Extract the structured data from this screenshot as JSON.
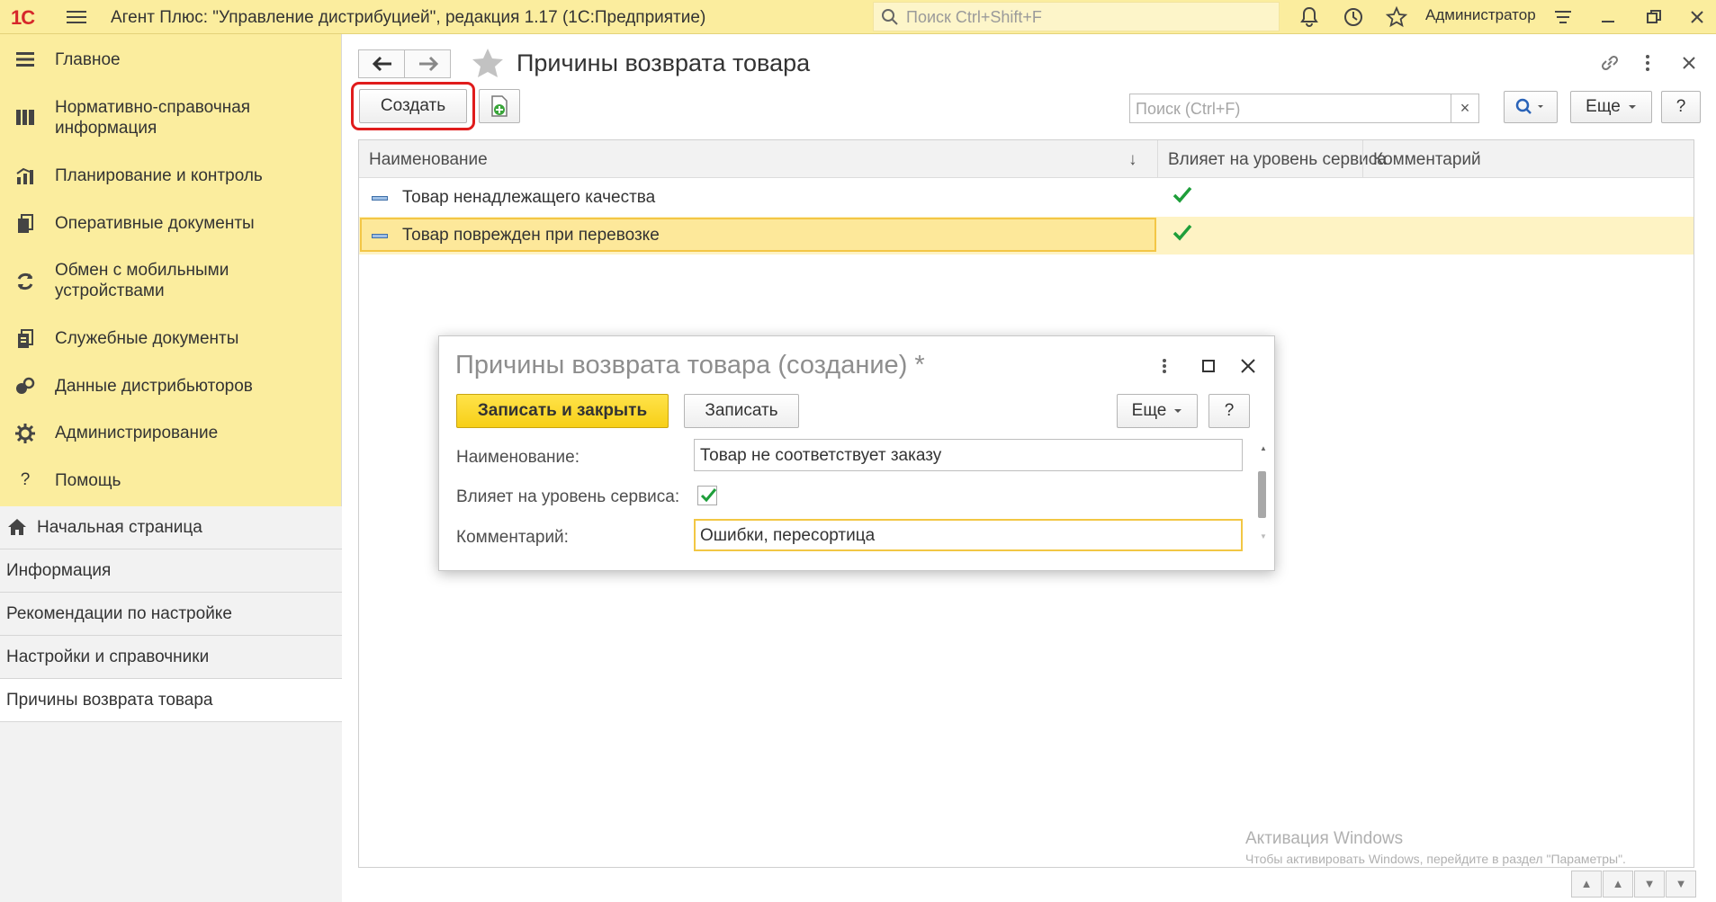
{
  "titlebar": {
    "logo": "1С",
    "title": "Агент Плюс: \"Управление дистрибуцией\", редакция 1.17  (1С:Предприятие)",
    "search_placeholder": "Поиск Ctrl+Shift+F",
    "user": "Администратор"
  },
  "sidebar": {
    "sections": [
      {
        "label": "Главное",
        "icon": "menu-lines-icon"
      },
      {
        "label": "Нормативно-справочная информация",
        "icon": "bars-chart-icon"
      },
      {
        "label": "Планирование и контроль",
        "icon": "growth-chart-icon"
      },
      {
        "label": "Оперативные документы",
        "icon": "documents-icon"
      },
      {
        "label": "Обмен с мобильными устройствами",
        "icon": "sync-icon"
      },
      {
        "label": "Служебные документы",
        "icon": "service-docs-icon"
      },
      {
        "label": "Данные дистрибьюторов",
        "icon": "distributors-icon"
      },
      {
        "label": "Администрирование",
        "icon": "gear-icon"
      },
      {
        "label": "Помощь",
        "icon": "question-icon"
      }
    ],
    "open_windows": [
      {
        "label": "Начальная страница",
        "icon": "home-icon"
      },
      {
        "label": "Информация"
      },
      {
        "label": "Рекомендации по настройке"
      },
      {
        "label": "Настройки и справочники"
      },
      {
        "label": "Причины возврата товара"
      }
    ]
  },
  "main": {
    "title": "Причины возврата товара",
    "create_label": "Создать",
    "search_placeholder": "Поиск (Ctrl+F)",
    "search_clear": "×",
    "more_label": "Еще",
    "help_label": "?",
    "columns": [
      "Наименование",
      "Влияет на уровень сервиса",
      "Комментарий"
    ],
    "sort_indicator": "↓",
    "rows": [
      {
        "name": "Товар ненадлежащего качества",
        "affects_service": true,
        "comment": ""
      },
      {
        "name": "Товар поврежден при перевозке",
        "affects_service": true,
        "comment": ""
      }
    ]
  },
  "modal": {
    "title": "Причины возврата товара (создание) *",
    "save_close_label": "Записать и закрыть",
    "save_label": "Записать",
    "more_label": "Еще",
    "help_label": "?",
    "name_label": "Наименование:",
    "name_value": "Товар не соответствует заказу",
    "affects_label": "Влияет на уровень сервиса:",
    "affects_checked": true,
    "comment_label": "Комментарий:",
    "comment_value": "Ошибки, пересортица"
  },
  "watermark": {
    "line1": "Активация Windows",
    "line2": "Чтобы активировать Windows, перейдите в раздел \"Параметры\"."
  },
  "colors": {
    "accent_yellow": "#fbed9e",
    "primary_button": "#f7cf17",
    "check_green": "#1e9e3a",
    "highlight_red": "#e01c1c"
  }
}
